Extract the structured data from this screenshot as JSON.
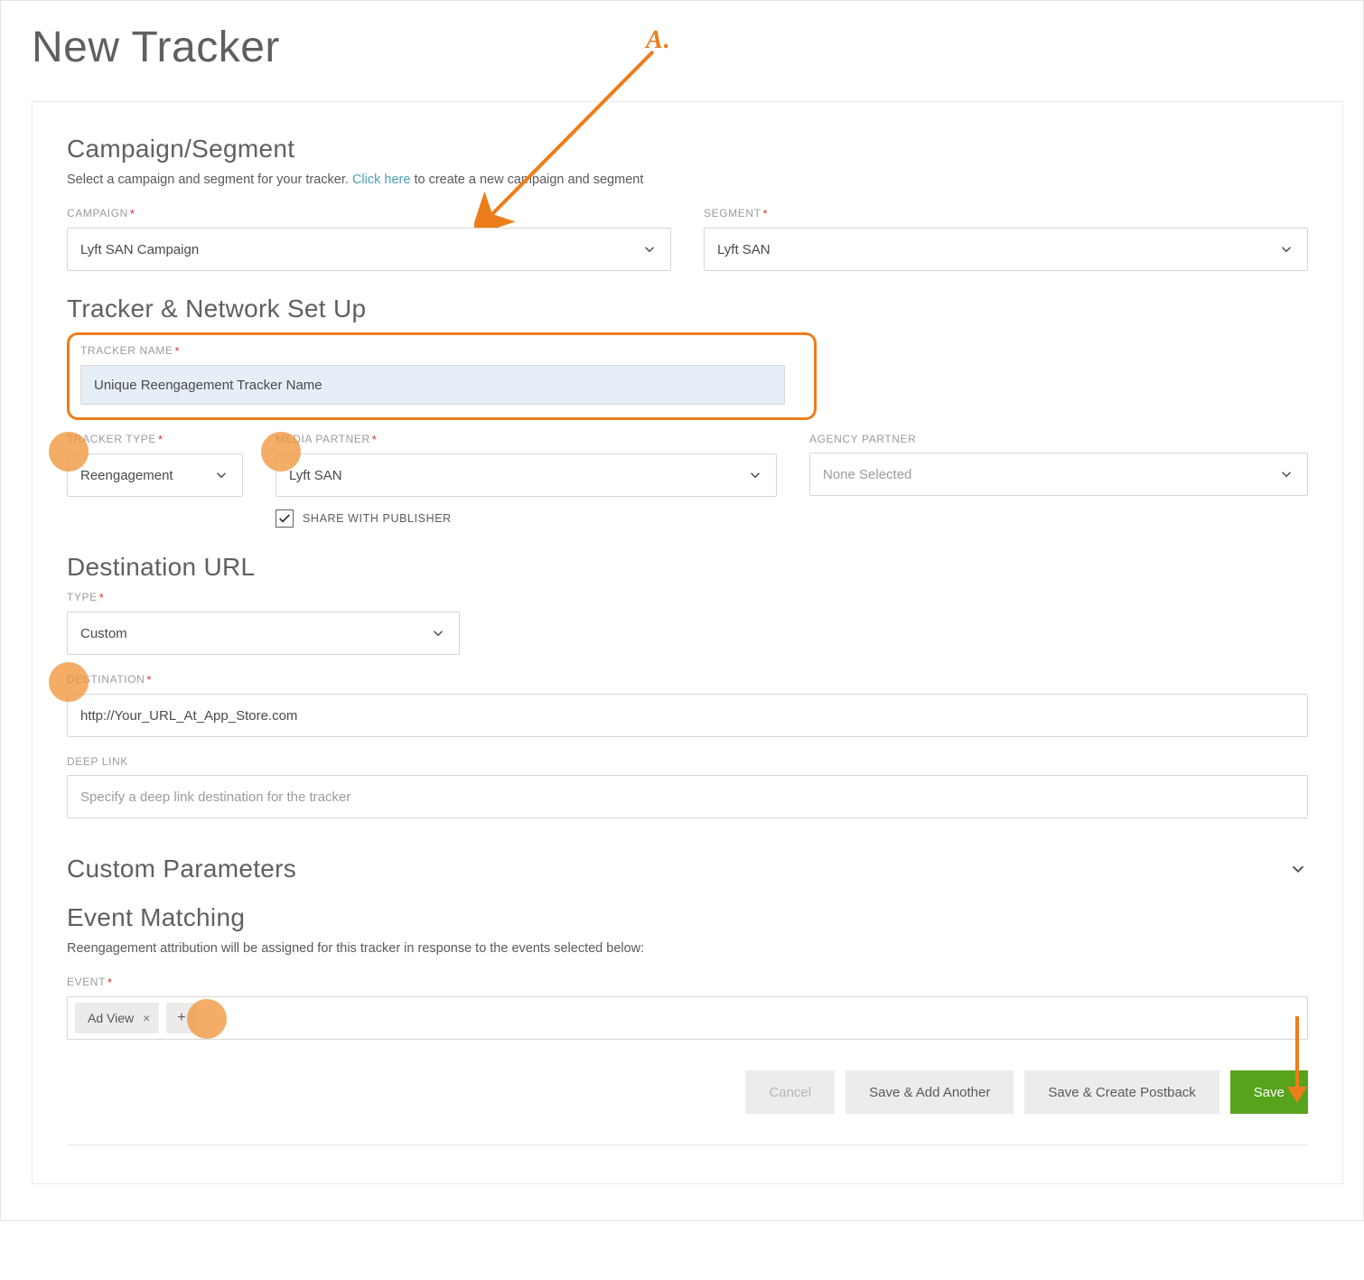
{
  "page": {
    "title": "New Tracker"
  },
  "annotations": {
    "label_a": "A."
  },
  "campaign_section": {
    "title": "Campaign/Segment",
    "subtitle_pre": "Select a campaign and segment for your tracker. ",
    "subtitle_link": "Click here",
    "subtitle_post": " to create a new campaign and segment",
    "campaign_label": "CAMPAIGN",
    "campaign_value": "Lyft SAN Campaign",
    "segment_label": "SEGMENT",
    "segment_value": "Lyft SAN"
  },
  "tracker_section": {
    "title": "Tracker & Network Set Up",
    "name_label": "TRACKER NAME",
    "name_value": "Unique Reengagement Tracker Name",
    "type_label": "TRACKER TYPE",
    "type_value": "Reengagement",
    "media_label": "MEDIA PARTNER",
    "media_value": "Lyft SAN",
    "agency_label": "AGENCY PARTNER",
    "agency_value": "None Selected",
    "share_label": "SHARE WITH PUBLISHER"
  },
  "destination_section": {
    "title": "Destination URL",
    "type_label": "TYPE",
    "type_value": "Custom",
    "dest_label": "DESTINATION",
    "dest_value": "http://Your_URL_At_App_Store.com",
    "deep_label": "DEEP LINK",
    "deep_placeholder": "Specify a deep link destination for the tracker"
  },
  "custom_params": {
    "title": "Custom Parameters"
  },
  "event_section": {
    "title": "Event Matching",
    "subtitle": "Reengagement attribution will be assigned for this tracker in response to the events selected below:",
    "event_label": "EVENT",
    "chip_value": "Ad View",
    "chip_remove": "×",
    "chip_add": "+"
  },
  "buttons": {
    "cancel": "Cancel",
    "save_add": "Save & Add Another",
    "save_postback": "Save & Create Postback",
    "save": "Save"
  }
}
